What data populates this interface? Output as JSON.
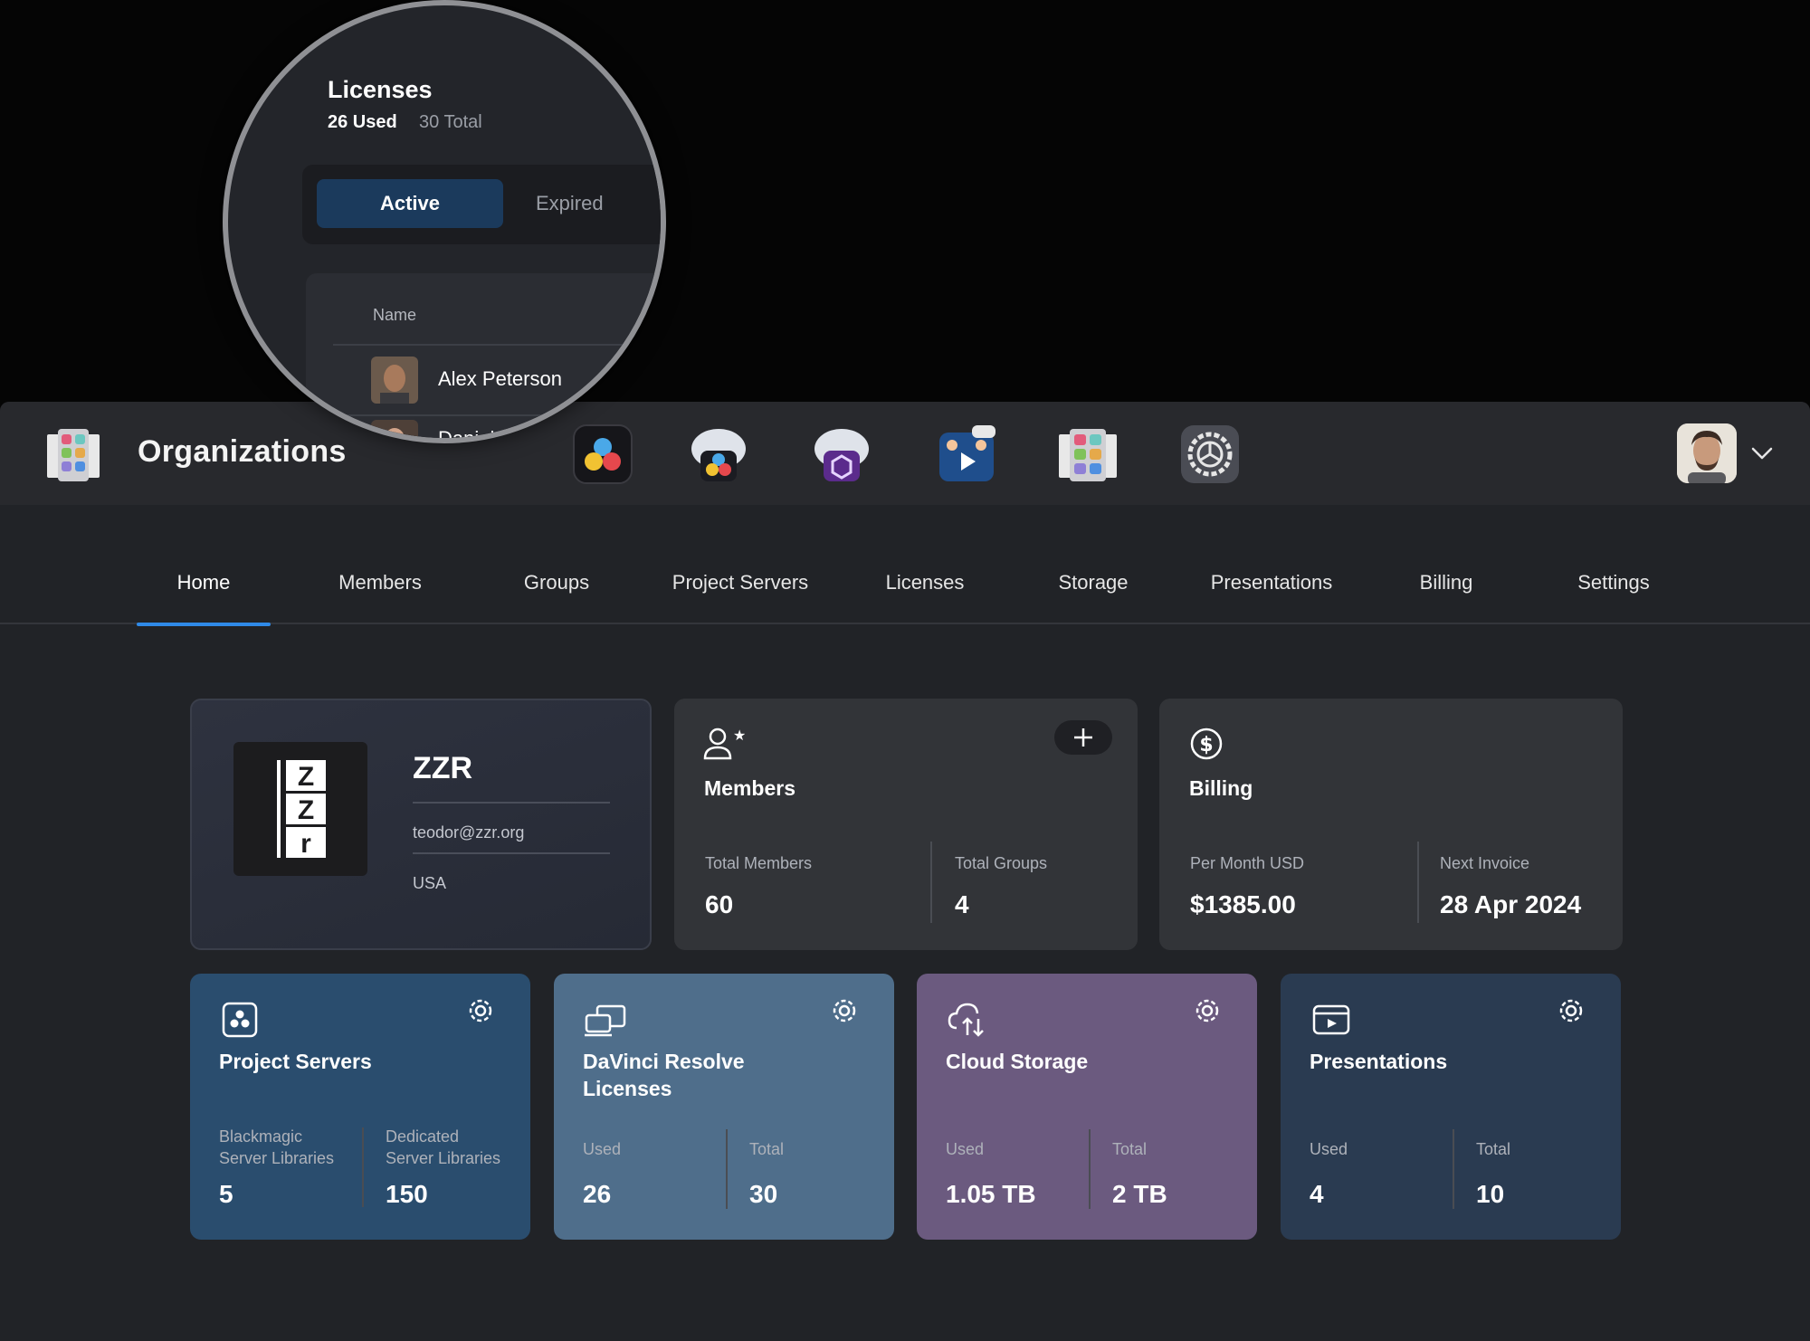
{
  "app": {
    "title": "Organizations",
    "dock": [
      "davinci-resolve-icon",
      "cloud-resolve-icon",
      "cloud-server-icon",
      "presentations-icon",
      "organizations-icon",
      "settings-icon"
    ]
  },
  "tabs": [
    {
      "label": "Home",
      "active": true
    },
    {
      "label": "Members"
    },
    {
      "label": "Groups"
    },
    {
      "label": "Project Servers"
    },
    {
      "label": "Licenses"
    },
    {
      "label": "Storage"
    },
    {
      "label": "Presentations"
    },
    {
      "label": "Billing"
    },
    {
      "label": "Settings"
    }
  ],
  "org": {
    "name": "ZZR",
    "email": "teodor@zzr.org",
    "country": "USA",
    "logo_letters": [
      "Z",
      "Z",
      "r"
    ]
  },
  "members": {
    "title": "Members",
    "total_members_label": "Total Members",
    "total_members": "60",
    "total_groups_label": "Total Groups",
    "total_groups": "4"
  },
  "billing": {
    "title": "Billing",
    "per_month_label": "Per Month USD",
    "per_month": "$1385.00",
    "next_invoice_label": "Next Invoice",
    "next_invoice": "28 Apr 2024"
  },
  "tiles": {
    "project_servers": {
      "title": "Project Servers",
      "left_label_1": "Blackmagic",
      "left_label_2": "Server Libraries",
      "left_value": "5",
      "right_label_1": "Dedicated",
      "right_label_2": "Server Libraries",
      "right_value": "150"
    },
    "licenses": {
      "title_1": "DaVinci Resolve",
      "title_2": "Licenses",
      "used_label": "Used",
      "used": "26",
      "total_label": "Total",
      "total": "30"
    },
    "cloud": {
      "title": "Cloud Storage",
      "used_label": "Used",
      "used": "1.05 TB",
      "total_label": "Total",
      "total": "2 TB"
    },
    "presentations": {
      "title": "Presentations",
      "used_label": "Used",
      "used": "4",
      "total_label": "Total",
      "total": "10"
    }
  },
  "lens": {
    "title": "Licenses",
    "used": "26 Used",
    "total": "30 Total",
    "seg_active": "Active",
    "seg_expired": "Expired",
    "col_name": "Name",
    "rows": [
      "Alex Peterson",
      "Daniel N"
    ]
  },
  "colors": {
    "accent": "#2f8ae8",
    "project_servers": "#2a4d6e",
    "licenses": "#4f6e8b",
    "cloud_storage": "#6b5a7f",
    "presentations": "#2a3b51"
  }
}
